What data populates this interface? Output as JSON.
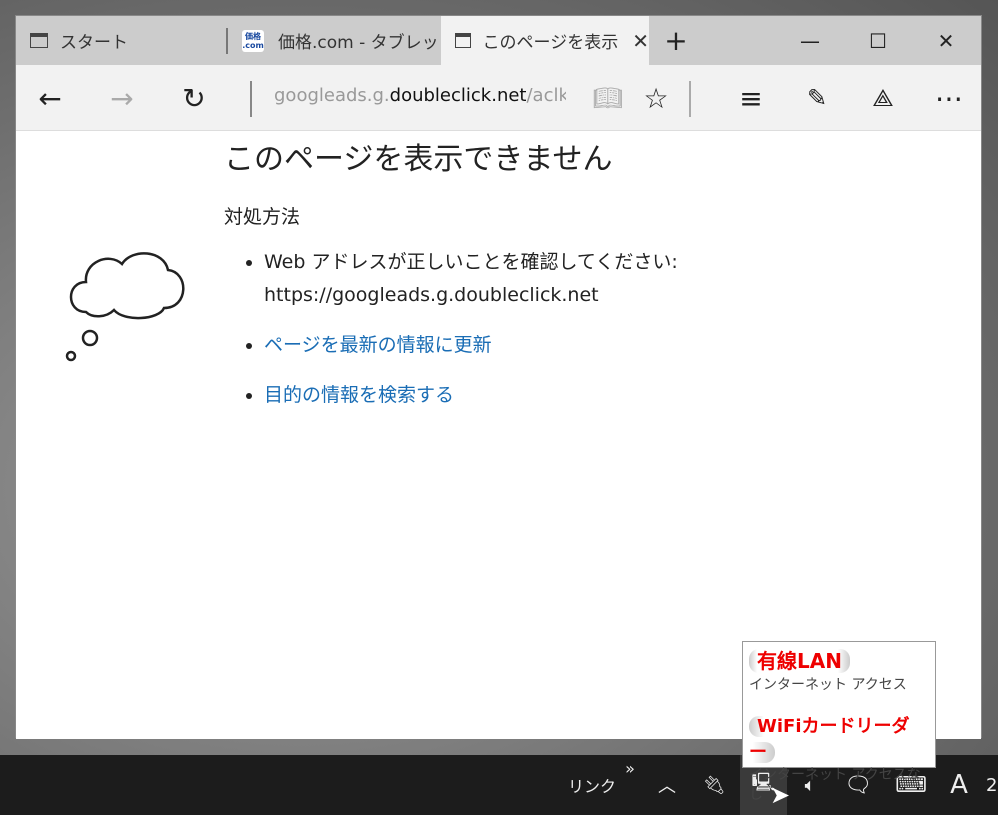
{
  "tabs": [
    {
      "label": "スタート"
    },
    {
      "label": "価格.com - タブレッ",
      "favicon": "価格 .com"
    },
    {
      "label": "このページを表示"
    }
  ],
  "new_tab": "+",
  "window_buttons": {
    "minimize": "—",
    "maximize": "☐",
    "close": "✕"
  },
  "address": {
    "prefix": "googleads.g.",
    "domain": "doubleclick.net",
    "suffix": "/aclk?s"
  },
  "page": {
    "title": "このページを表示できません",
    "subtitle": "対処方法",
    "items": [
      {
        "text": "Web アドレスが正しいことを確認してください:",
        "text2": "https://googleads.g.doubleclick.net"
      },
      {
        "link": "ページを最新の情報に更新"
      },
      {
        "link": "目的の情報を検索する"
      }
    ]
  },
  "taskbar": {
    "links": "リンク",
    "chevrons": "»",
    "ime": "A",
    "clock": "2"
  },
  "network_tooltip": {
    "items": [
      {
        "name": "有線LAN",
        "status": "インターネット アクセス"
      },
      {
        "name": "WiFiカードリーダー",
        "status": "インターネット アクセスなし"
      }
    ]
  },
  "colors": {
    "link": "#1a6db5",
    "accent_red": "#e00000"
  }
}
